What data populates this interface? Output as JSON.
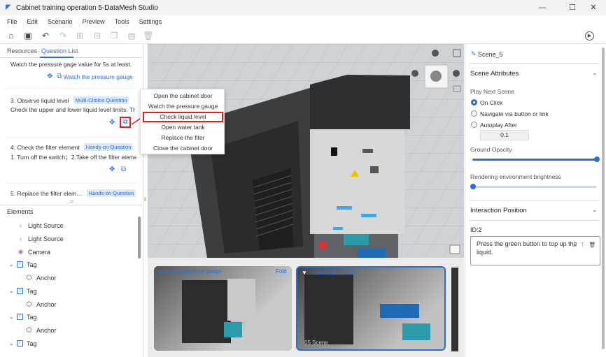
{
  "window": {
    "title": "Cabinet training operation 5-DataMesh Studio",
    "controls": [
      "—",
      "☐",
      "✕"
    ]
  },
  "menu": [
    "File",
    "Edit",
    "Scenario",
    "Preview",
    "Tools",
    "Settings"
  ],
  "left_tabs": {
    "resources": "Resources",
    "question_list": "Question List"
  },
  "questions": {
    "q2_desc": "Watch the pressure gage value for 5s at least.",
    "q2_link": "Watch the pressure gauge",
    "q3_title": "3. Observe liquid level",
    "q3_badge": "Multi-Choice Question",
    "q3_desc": "Check the upper and lower liquid level limits. Th…",
    "q4_title": "4. Check the filter element",
    "q4_badge": "Hands-on Question",
    "q4_desc": "1. Turn off the switch；2.Take off the filter element",
    "q5_title": "5. Replace the filter elem…",
    "q5_badge": "Hands-on Question"
  },
  "elements": {
    "header": "Elements",
    "items": [
      {
        "label": "Light Source",
        "icon": "bulb-icon"
      },
      {
        "label": "Light Source",
        "icon": "bulb-icon"
      },
      {
        "label": "Camera",
        "icon": "camera-icon"
      },
      {
        "label": "Tag",
        "icon": "tag-icon"
      },
      {
        "label": "Anchor",
        "icon": "cube-icon"
      },
      {
        "label": "Tag",
        "icon": "tag-icon"
      },
      {
        "label": "Anchor",
        "icon": "cube-icon"
      },
      {
        "label": "Tag",
        "icon": "tag-icon"
      },
      {
        "label": "Anchor",
        "icon": "cube-icon"
      },
      {
        "label": "Tag",
        "icon": "tag-icon"
      }
    ]
  },
  "context_menu": {
    "items": [
      "Open the cabinet door",
      "Watch the pressure gauge",
      "Check liquid level",
      "Open water tank",
      "Replace the fiter",
      "Close the cabinet door"
    ],
    "highlighted": "Check liquid level"
  },
  "viewport": {
    "cabinet_label": ""
  },
  "thumbnails": {
    "t1_label": "Watch the pressure gauge",
    "t1_fold": "Fold",
    "t2_label": "Check liquid level",
    "t2_scene": "05 Scene"
  },
  "right_panel": {
    "scene_name": "Scene_5",
    "scene_attributes": "Scene Attributes",
    "play_next": "Play Next Scene",
    "opt_on_click": "On Click",
    "opt_navigate": "Navigate via button or link",
    "opt_autoplay": "Autoplay After",
    "autoplay_value": "0.1",
    "ground_opacity": "Ground Opacity",
    "ground_opacity_value": 1.0,
    "render_brightness": "Rendering environment brightness",
    "render_brightness_value": 0.0,
    "interaction_position": "Interaction Position",
    "id_label": "ID:2",
    "note_text": "Press the green button to top up the liquid."
  },
  "colors": {
    "accent": "#2b6fd6",
    "highlight_red": "#e02020"
  }
}
